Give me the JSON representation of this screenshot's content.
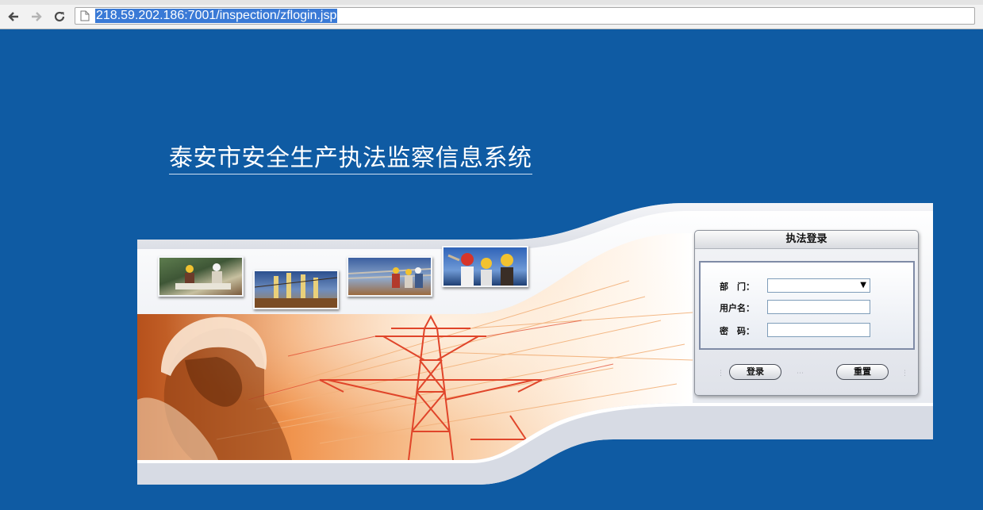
{
  "browser": {
    "url": "218.59.202.186:7001/inspection/zflogin.jsp"
  },
  "page": {
    "title": "泰安市安全生产执法监察信息系统"
  },
  "login": {
    "heading": "执法登录",
    "dept_label": "部　门：",
    "user_label": "用户名：",
    "pass_label": "密　码：",
    "dept_value": "",
    "username_value": "",
    "password_value": "",
    "login_button": "登录",
    "reset_button": "重置"
  },
  "colors": {
    "background": "#0f5ba3",
    "banner_orange": "#f0944e",
    "tower_red": "#e0452a"
  },
  "icons": [
    "back-arrow-icon",
    "forward-arrow-icon",
    "reload-icon",
    "page-icon",
    "dropdown-arrow-icon"
  ]
}
